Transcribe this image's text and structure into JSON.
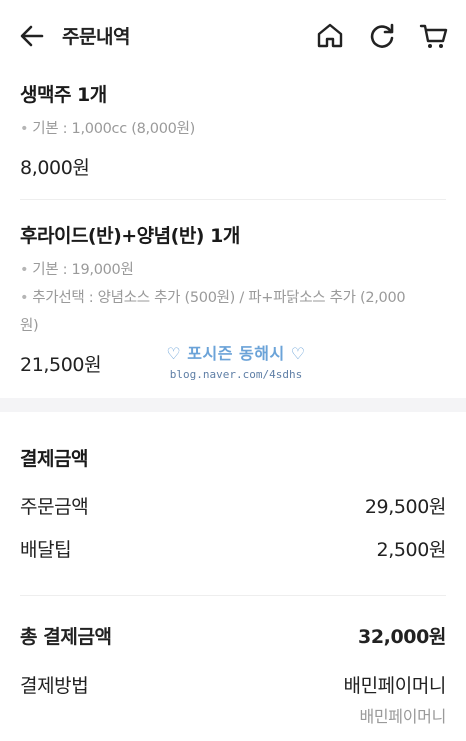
{
  "header": {
    "title": "주문내역",
    "icons": [
      "back-arrow-icon",
      "home-icon",
      "refresh-icon",
      "cart-icon"
    ]
  },
  "items": [
    {
      "name": "생맥주 1개",
      "options": [
        "기본 : 1,000cc (8,000원)"
      ],
      "price": "8,000원"
    },
    {
      "name": "후라이드(반)+양념(반) 1개",
      "options": [
        "기본 : 19,000원",
        "추가선택 : 양념소스 추가 (500원) / 파+파닭소스 추가 (2,000",
        "원)"
      ],
      "price": "21,500원"
    }
  ],
  "watermark": {
    "title": "♡ 포시즌 동해시 ♡",
    "url": "blog.naver.com/4sdhs"
  },
  "payment": {
    "title": "결제금액",
    "order_amount_label": "주문금액",
    "order_amount": "29,500원",
    "delivery_tip_label": "배달팁",
    "delivery_tip": "2,500원",
    "total_label": "총 결제금액",
    "total": "32,000원",
    "method_label": "결제방법",
    "method": "배민페이머니",
    "method_sub": "배민페이머니"
  }
}
